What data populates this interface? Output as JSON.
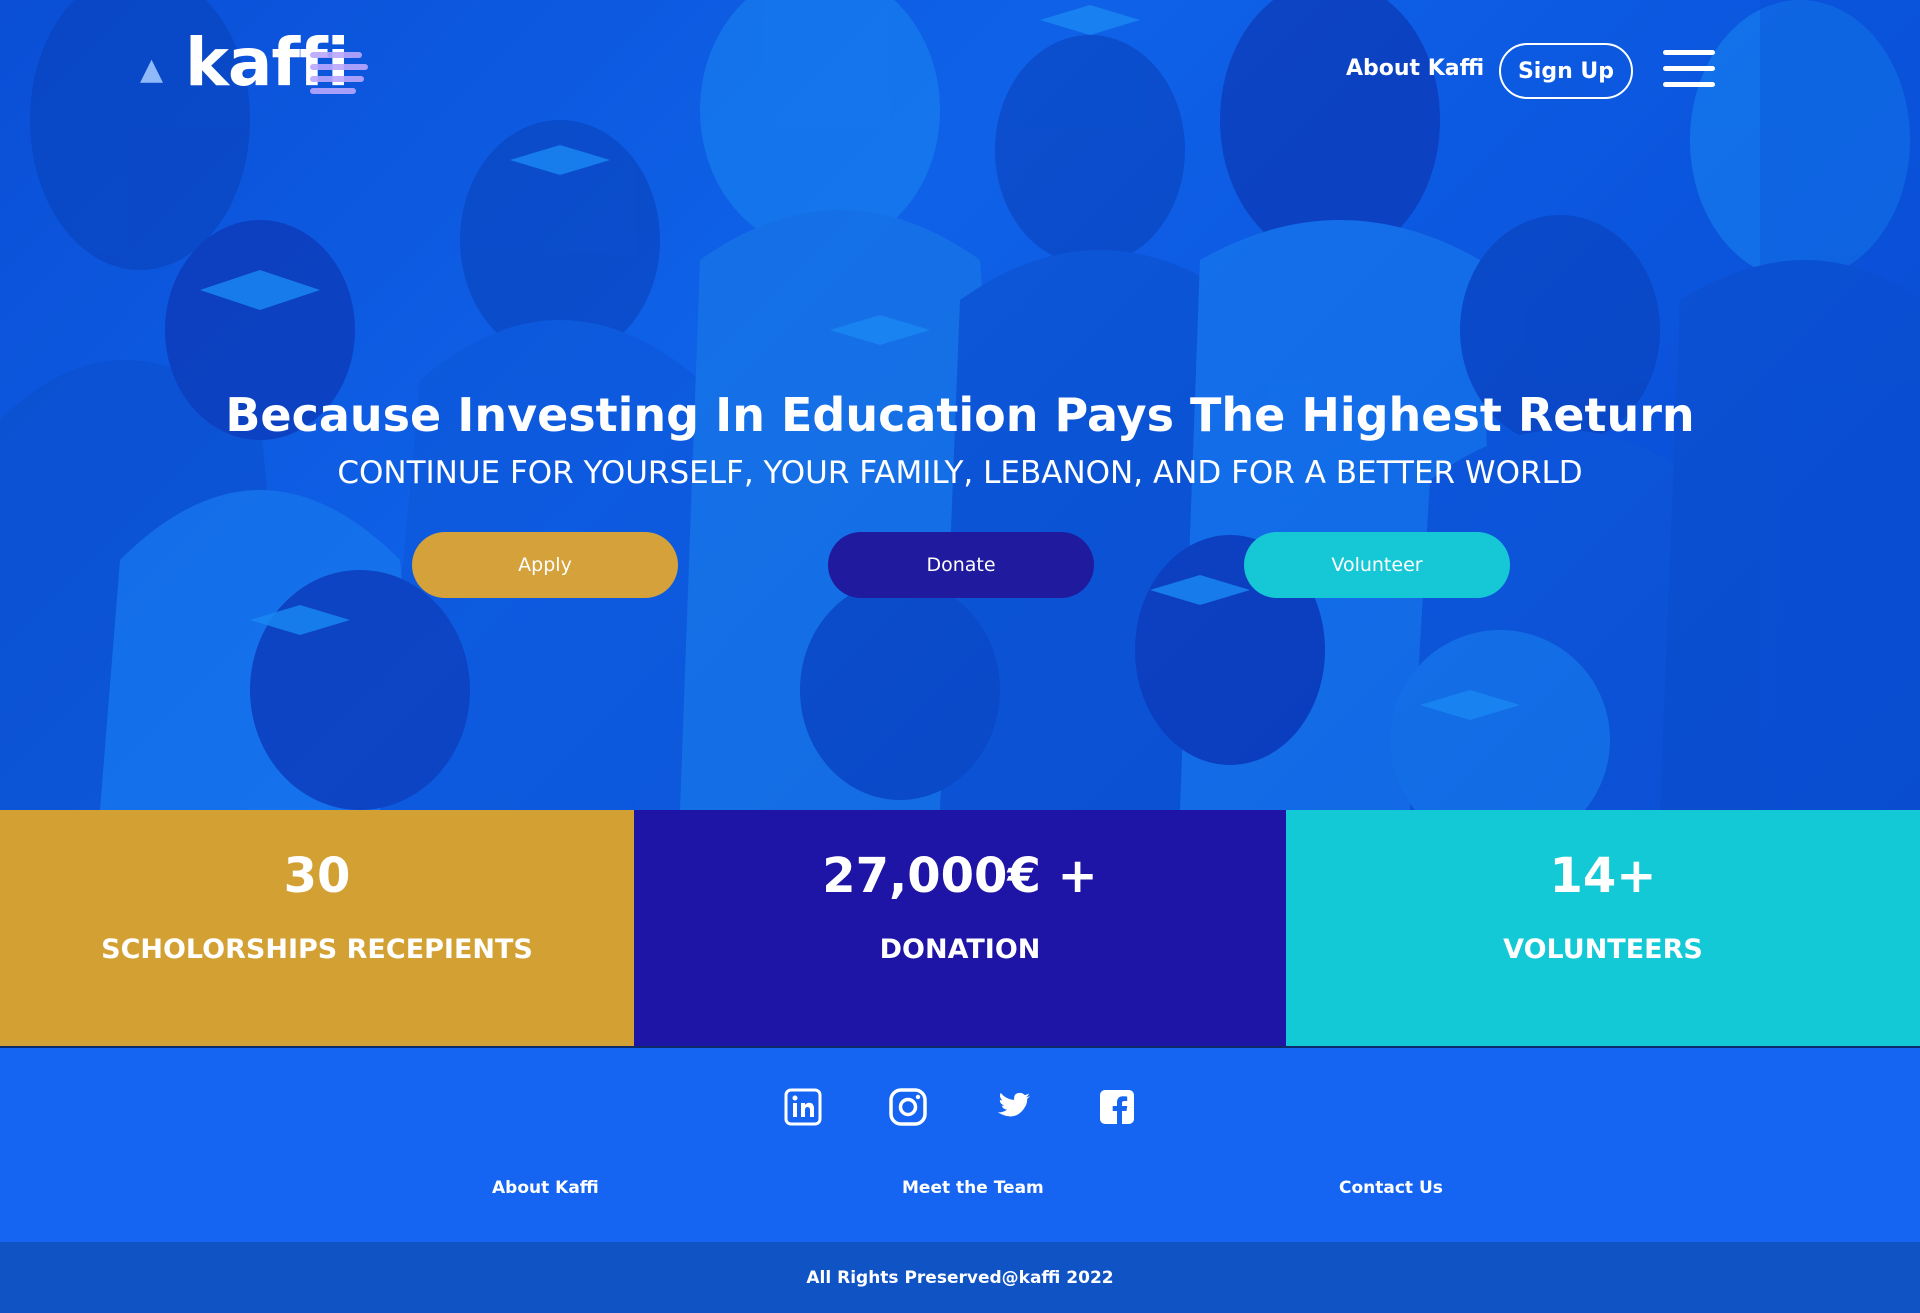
{
  "header": {
    "logo_text": "kaffi",
    "nav_about": "About Kaffi",
    "nav_signup": "Sign Up"
  },
  "hero": {
    "title": "Because Investing In Education Pays The Highest Return",
    "subtitle": "CONTINUE FOR YOURSELF, YOUR FAMILY, LEBANON, AND FOR A BETTER WORLD",
    "buttons": {
      "apply": "Apply",
      "donate": "Donate",
      "volunteer": "Volunteer"
    }
  },
  "stats": [
    {
      "value": "30",
      "label": "SCHOLORSHIPS RECEPIENTS",
      "color": "#d3a133"
    },
    {
      "value": "27,000€ +",
      "label": "DONATION",
      "color": "#1e14a6"
    },
    {
      "value": "14+",
      "label": "VOLUNTEERS",
      "color": "#14c9d6"
    }
  ],
  "footer": {
    "social": [
      "linkedin-icon",
      "instagram-icon",
      "twitter-icon",
      "facebook-icon"
    ],
    "links": {
      "about": "About Kaffi",
      "team": "Meet the Team",
      "contact": "Contact Us"
    },
    "copyright": "All Rights Preserved@kaffi 2022"
  },
  "colors": {
    "hero_blue": "#0f62e8",
    "footer_blue": "#1565f2",
    "bottom_bar": "#1053c4",
    "apply": "#d4a13a",
    "donate": "#201a9e",
    "volunteer": "#16c8d6"
  }
}
